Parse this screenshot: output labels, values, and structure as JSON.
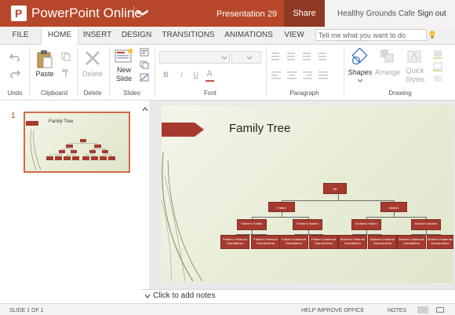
{
  "titlebar": {
    "app_name": "PowerPoint Online",
    "chevron": "❯",
    "logo_letter": "P",
    "doc_title": "Presentation 29",
    "share_label": "Share",
    "user_name": "Healthy Grounds Cafe",
    "sign_out_label": "Sign out"
  },
  "tabs": [
    {
      "label": "FILE"
    },
    {
      "label": "HOME"
    },
    {
      "label": "INSERT"
    },
    {
      "label": "DESIGN"
    },
    {
      "label": "TRANSITIONS"
    },
    {
      "label": "ANIMATIONS"
    },
    {
      "label": "VIEW"
    }
  ],
  "active_tab": "HOME",
  "search": {
    "placeholder": "Tell me what you want to do"
  },
  "ribbon": {
    "groups": {
      "undo": "Undo",
      "clipboard": "Clipboard",
      "delete": "Delete",
      "slides": "Slides",
      "font": "Font",
      "paragraph": "Paragraph",
      "drawing": "Drawing"
    },
    "buttons": {
      "paste": "Paste",
      "delete": "Delete",
      "new_slide_1": "New",
      "new_slide_2": "Slide",
      "shapes": "Shapes",
      "arrange": "Arrange",
      "quick_styles_1": "Quick",
      "quick_styles_2": "Styles"
    },
    "font_format": {
      "bold": "B",
      "italic": "I",
      "underline": "U",
      "color": "A"
    }
  },
  "thumbnails": [
    {
      "number": "1",
      "title": "Family Tree"
    }
  ],
  "slide": {
    "title": "Family Tree",
    "tree": {
      "root": "Me",
      "parents": [
        "Father",
        "Mother"
      ],
      "grandparents": [
        "Father's Father",
        "Father's Mother",
        "Mother's Father",
        "Mother's Mother"
      ],
      "great_grandparents": [
        "Father's Paternal Grandfather",
        "Father's Paternal Grandmother",
        "Father's Maternal Grandfather",
        "Father's Maternal Grandmother",
        "Mother's Paternal Grandfather",
        "Mother's Paternal Grandmother",
        "Mother's Maternal Grandfather",
        "Mother's Maternal Grandmother"
      ]
    }
  },
  "notes": {
    "placeholder": "Click to add notes"
  },
  "status": {
    "slide_info": "SLIDE 1 OF 1",
    "help": "HELP IMPROVE OFFICE",
    "notes": "NOTES"
  },
  "colors": {
    "accent": "#b7472a",
    "box": "#a63a2e"
  }
}
